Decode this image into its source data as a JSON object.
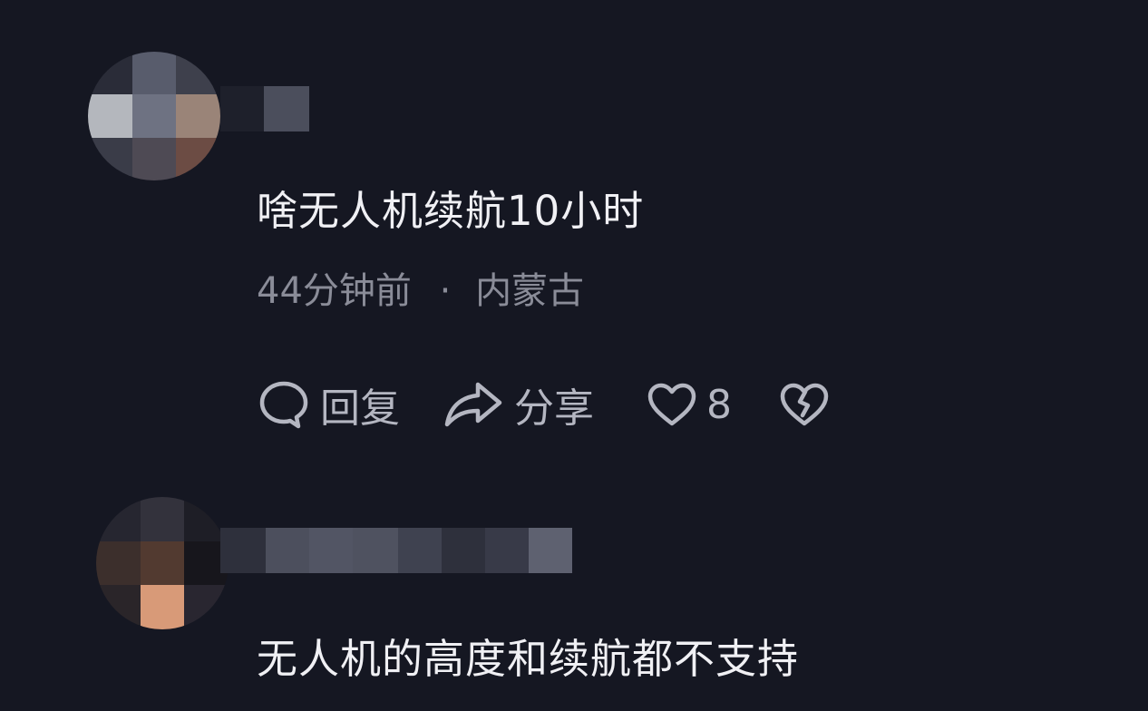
{
  "comments": [
    {
      "text": "啥无人机续航10小时",
      "time": "44分钟前",
      "separator": "·",
      "location": "内蒙古",
      "actions": {
        "reply_label": "回复",
        "share_label": "分享",
        "like_count": "8"
      },
      "avatar_blurred": true,
      "username_blurred": true
    },
    {
      "text": "无人机的高度和续航都不支持",
      "avatar_blurred": true,
      "username_blurred": true
    }
  ],
  "icons": {
    "reply": "comment-bubble-icon",
    "share": "share-arrow-icon",
    "like": "heart-icon",
    "dislike": "broken-heart-icon"
  },
  "colors": {
    "background": "#151722",
    "primary_text": "#f0f0f4",
    "secondary_text": "#8a8c98",
    "action_text": "#b4b6c1"
  }
}
